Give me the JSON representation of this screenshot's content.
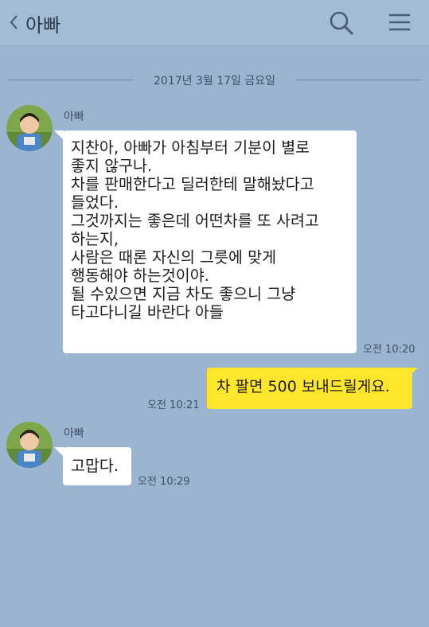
{
  "header": {
    "back_icon": "chevron-left-icon",
    "title": "아빠",
    "search_icon": "search-icon",
    "menu_icon": "menu-icon"
  },
  "date_separator": "2017년 3월 17일 금요일",
  "messages": [
    {
      "direction": "incoming",
      "sender": "아빠",
      "text": "지찬아, 아빠가 아침부터 기분이 별로\n좋지 않구나.\n차를 판매한다고 딜러한테 말해놨다고\n들었다.\n그것까지는 좋은데 어떤차를 또 사려고\n하는지,\n사람은 때론 자신의 그릇에 맞게\n행동해야 하는것이야.\n될 수있으면 지금 차도 좋으니 그냥\n타고다니길 바란다 아들",
      "time": "오전 10:20"
    },
    {
      "direction": "outgoing",
      "text": "차 팔면 500 보내드릴게요.",
      "time": "오전 10:21"
    },
    {
      "direction": "incoming",
      "sender": "아빠",
      "text": "고맙다.",
      "time": "오전 10:29"
    }
  ],
  "colors": {
    "background": "#9bb5d0",
    "incoming_bubble": "#ffffff",
    "outgoing_bubble": "#fee62a"
  }
}
